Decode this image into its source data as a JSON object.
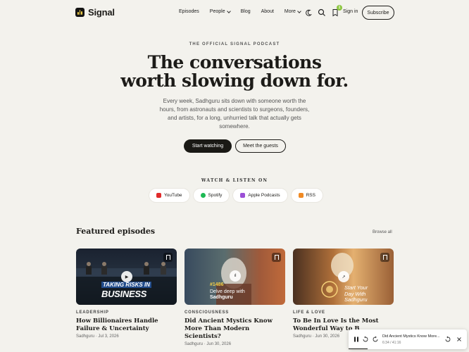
{
  "header": {
    "logo": "Signal",
    "nav": [
      {
        "label": "Episodes",
        "dropdown": false
      },
      {
        "label": "People",
        "dropdown": true
      },
      {
        "label": "Blog",
        "dropdown": false
      },
      {
        "label": "About",
        "dropdown": false
      },
      {
        "label": "More",
        "dropdown": true
      }
    ],
    "notif_count": "1",
    "signin": "Sign in",
    "subscribe": "Subscribe"
  },
  "hero": {
    "eyebrow": "THE OFFICIAL SIGNAL PODCAST",
    "title_line1": "The conversations",
    "title_line2": "worth slowing down for.",
    "subtitle": "Every week, Sadhguru sits down with someone worth the hours, from astronauts and scientists to surgeons, founders, and artists, for a long, unhurried talk that actually gets somewhere.",
    "primary_cta": "Start watching",
    "secondary_cta": "Meet the guests"
  },
  "watch": {
    "heading": "WATCH & LISTEN ON",
    "platforms": [
      {
        "label": "YouTube",
        "color": "#e02b2b"
      },
      {
        "label": "Spotify",
        "color": "#1db954"
      },
      {
        "label": "Apple Podcasts",
        "color": "#9b4fd6"
      },
      {
        "label": "RSS",
        "color": "#f08a24"
      }
    ]
  },
  "featured": {
    "heading": "Featured episodes",
    "browse": "Browse all",
    "cards": [
      {
        "category": "LEADERSHIP",
        "title": "How Billionaires Handle Failure & Uncertainty",
        "author": "Sadhguru",
        "date": "Jul 3, 2026",
        "overlay_line1": "TAKING RISKS IN",
        "overlay_line2": "BUSINESS"
      },
      {
        "category": "CONSCIOUSNESS",
        "title": "Did Ancient Mystics Know More Than Modern Scientists?",
        "author": "Sadhguru",
        "date": "Jun 30, 2026",
        "overlay_line1": "#1486",
        "overlay_line2": "Delve deep with",
        "overlay_line3": "Sadhguru"
      },
      {
        "category": "LIFE & LOVE",
        "title": "To Be In Love Is the Most Wonderful Way to B",
        "author": "Sadhguru",
        "date": "Jun 30, 2026",
        "overlay_line1": "Start Your",
        "overlay_line2": "Day With",
        "overlay_line3": "Sadhguru"
      }
    ]
  },
  "player": {
    "title": "Did Ancient Mystics Know More...",
    "time": "6:34 / 41:16",
    "progress_percent": 16
  }
}
